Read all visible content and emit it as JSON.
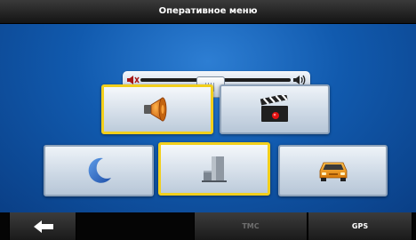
{
  "window": {
    "title": "Оперативное меню"
  },
  "volume": {
    "level": 0.47,
    "min_icon": "speaker-muted-icon",
    "max_icon": "speaker-loud-icon"
  },
  "tiles": [
    {
      "icon": "speaker-icon",
      "selected": true
    },
    {
      "icon": "clapperboard-icon",
      "selected": false
    },
    {
      "icon": "crescent-moon-icon",
      "selected": false
    },
    {
      "icon": "buildings-icon",
      "selected": true
    },
    {
      "icon": "car-icon",
      "selected": false
    }
  ],
  "bottom_bar": {
    "back_icon": "arrow-left-icon",
    "tmc_label": "TMC",
    "gps_label": "GPS"
  },
  "colors": {
    "selection_border": "#f2cf1c",
    "background_blue": "#115aae",
    "bar_dark": "#1a1a1a"
  }
}
